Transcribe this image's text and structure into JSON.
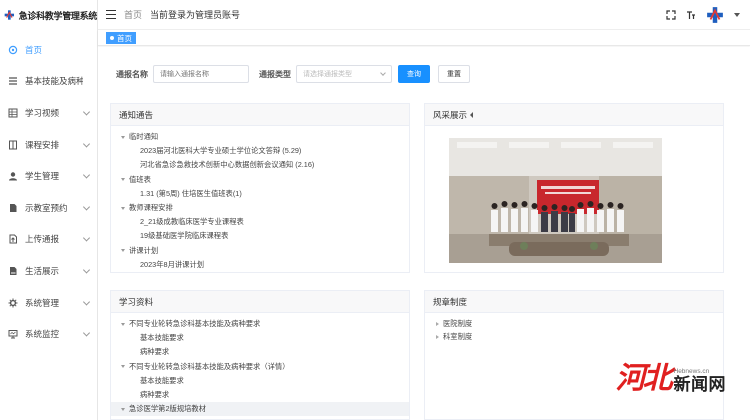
{
  "app": {
    "title": "急诊科教学管理系统"
  },
  "header": {
    "breadcrumbs": [
      "首页",
      "当前登录为管理员账号"
    ]
  },
  "sidebar": {
    "items": [
      {
        "label": "首页",
        "icon": "home-icon",
        "active": true,
        "has_arrow": false
      },
      {
        "label": "基本技能及病种...",
        "icon": "list-icon",
        "active": false,
        "has_arrow": false
      },
      {
        "label": "学习视频",
        "icon": "video-grid-icon",
        "active": false,
        "has_arrow": true
      },
      {
        "label": "课程安排",
        "icon": "book-icon",
        "active": false,
        "has_arrow": true
      },
      {
        "label": "学生管理",
        "icon": "user-icon",
        "active": false,
        "has_arrow": true
      },
      {
        "label": "示教室预约",
        "icon": "document-icon",
        "active": false,
        "has_arrow": true
      },
      {
        "label": "上传通报",
        "icon": "upload-doc-icon",
        "active": false,
        "has_arrow": true
      },
      {
        "label": "生活展示",
        "icon": "photo-doc-icon",
        "active": false,
        "has_arrow": true
      },
      {
        "label": "系统管理",
        "icon": "gear-icon",
        "active": false,
        "has_arrow": true
      },
      {
        "label": "系统监控",
        "icon": "monitor-icon",
        "active": false,
        "has_arrow": true
      }
    ]
  },
  "tags": {
    "active": "首页"
  },
  "search": {
    "name_label": "通报名称",
    "name_placeholder": "请输入通报名称",
    "type_label": "通报类型",
    "type_placeholder": "请选择通报类型",
    "query_button": "查询",
    "reset_button": "重置"
  },
  "notices": {
    "title": "通知通告",
    "rows": [
      {
        "text": "临时通知",
        "kind": "group"
      },
      {
        "text": "2023届河北医科大学专业硕士学位论文答辩 (5.29)",
        "kind": "child"
      },
      {
        "text": "河北省急诊急救技术创新中心数据创新会议通知 (2.16)",
        "kind": "child"
      },
      {
        "text": "值班表",
        "kind": "group"
      },
      {
        "text": "1.31 (第5周) 住培医生值班表(1)",
        "kind": "child"
      },
      {
        "text": "教师课程安排",
        "kind": "group"
      },
      {
        "text": "2_21级成教临床医学专业课程表",
        "kind": "child"
      },
      {
        "text": "19级基础医学院临床课程表",
        "kind": "child"
      },
      {
        "text": "讲课计划",
        "kind": "group"
      },
      {
        "text": "2023年8月讲课计划",
        "kind": "child"
      }
    ]
  },
  "gallery": {
    "title": "风采展示",
    "banner_text": "河北医科大学第一届急诊医学教学"
  },
  "materials": {
    "title": "学习资料",
    "rows": [
      {
        "text": "不同专业轮转急诊科基本技能及病种要求",
        "kind": "group"
      },
      {
        "text": "基本技能要求",
        "kind": "child"
      },
      {
        "text": "病种要求",
        "kind": "child"
      },
      {
        "text": "不同专业轮转急诊科基本技能及病种要求（详情）",
        "kind": "group"
      },
      {
        "text": "基本技能要求",
        "kind": "child"
      },
      {
        "text": "病种要求",
        "kind": "child"
      },
      {
        "text": "急诊医学第2版规培教材",
        "kind": "group"
      }
    ]
  },
  "rules": {
    "title": "规章制度",
    "rows": [
      "医院制度",
      "科室制度"
    ]
  },
  "watermark": {
    "logo": "河北",
    "url": "Hebnews.cn",
    "name": "新闻网"
  },
  "colors": {
    "accent": "#409eff",
    "primary_button": "#1890ff",
    "watermark_red": "#e02020"
  }
}
